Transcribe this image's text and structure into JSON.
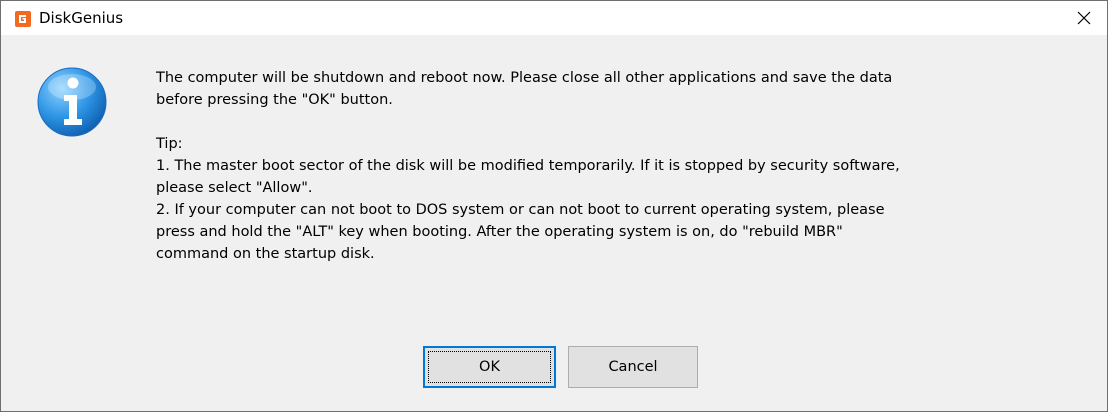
{
  "window": {
    "title": "DiskGenius",
    "app_icon": "diskgenius-logo-icon",
    "close_icon": "close-icon",
    "accent_color": "#0078d7"
  },
  "dialog": {
    "icon": "info-icon",
    "message": "The computer will be shutdown and reboot now. Please close all other applications and save the data\nbefore pressing the \"OK\" button.",
    "tip_heading": "Tip:",
    "tip_1": "1. The master boot sector of the disk will be modified temporarily. If it is stopped by security software,\nplease select \"Allow\".",
    "tip_2": "2. If your computer can not boot to DOS system or can not boot to current operating system, please\npress and hold the \"ALT\" key when booting. After the operating system is on, do \"rebuild MBR\"\ncommand on the startup disk."
  },
  "buttons": {
    "ok_label": "OK",
    "cancel_label": "Cancel"
  }
}
